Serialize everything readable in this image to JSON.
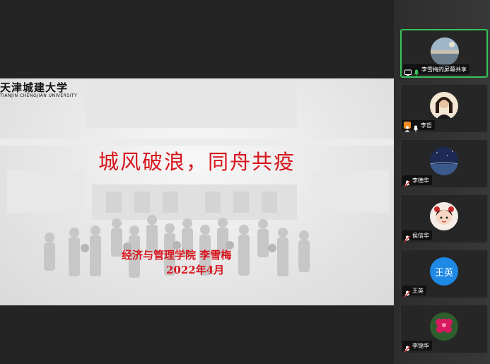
{
  "slide": {
    "university_name": "天津城建大学",
    "university_en": "TIANJIN CHENGJIAN UNIVERSITY",
    "title": "城风破浪，同舟共疫",
    "subtitle": "经济与管理学院  李雪梅",
    "date": "2022年4月"
  },
  "participants": [
    {
      "name": "李雪梅的屏幕共享",
      "avatar": "landscape",
      "active": true,
      "icon": "screen-share-icon",
      "mic": "mic-on-green"
    },
    {
      "name": "李哲",
      "avatar": "woman-portrait",
      "icon": "person-icon",
      "mic": "mic-on-white"
    },
    {
      "name": "李德华",
      "avatar": "night-sky",
      "icon": "mic-muted-icon"
    },
    {
      "name": "侯信华",
      "avatar": "cartoon-girl",
      "icon": "mic-muted-icon"
    },
    {
      "name": "王英",
      "avatar_text": "王英",
      "avatar_color": "#1e88e5",
      "icon": "mic-muted-icon"
    },
    {
      "name": "李锦华",
      "avatar": "red-flower",
      "icon": "mic-muted-icon"
    }
  ],
  "colors": {
    "title": "#d8141c",
    "active_border": "#37c35a",
    "initials_avatar": "#1e88e5"
  }
}
